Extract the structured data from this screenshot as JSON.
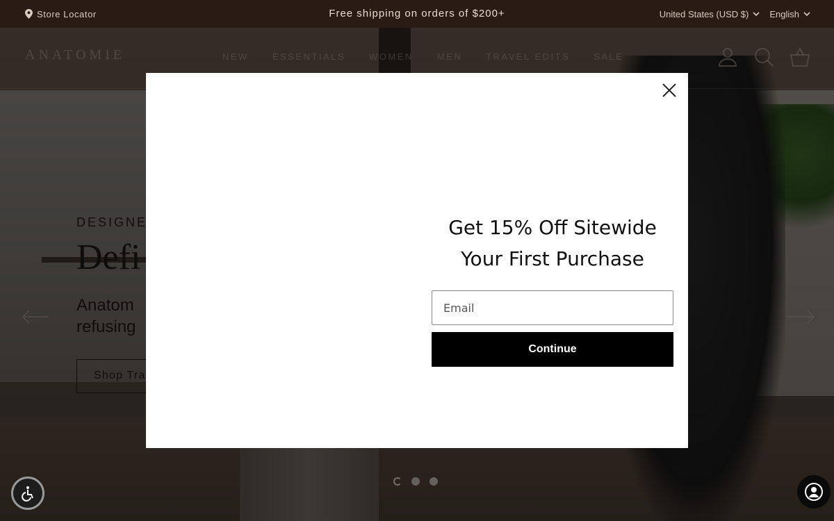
{
  "topbar": {
    "store_locator": "Store Locator",
    "announcement": "Free shipping on orders of $200+",
    "currency": "United States (USD $)",
    "language": "English"
  },
  "header": {
    "logo": "ANATOMIE",
    "nav": [
      "NEW",
      "ESSENTIALS",
      "WOMEN",
      "MEN",
      "TRAVEL EDITS",
      "SALE"
    ],
    "icons": [
      "account-icon",
      "search-icon",
      "cart-icon"
    ]
  },
  "hero": {
    "eyebrow": "DESIGNE",
    "headline": "Defi",
    "subtitle_line1": "Anatom",
    "subtitle_line2": "refusing",
    "cta": "Shop Tra",
    "slides": 3,
    "active_slide": 1
  },
  "popup": {
    "title_line1": "Get 15% Off Sitewide",
    "title_line2": "Your First Purchase",
    "email_placeholder": "Email",
    "button": "Continue"
  },
  "colors": {
    "topbar_bg": "#2a1c15",
    "button_bg": "#000000"
  }
}
